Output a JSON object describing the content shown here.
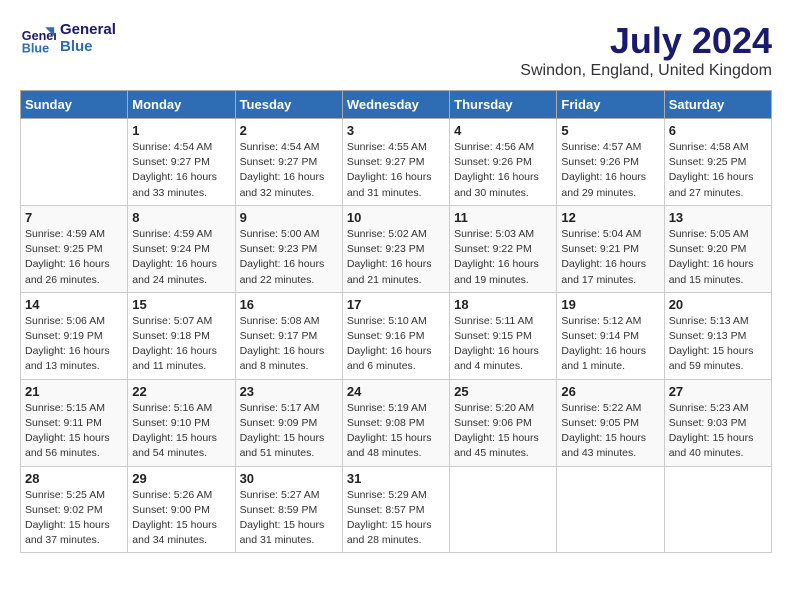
{
  "logo": {
    "line1": "General",
    "line2": "Blue"
  },
  "title": "July 2024",
  "location": "Swindon, England, United Kingdom",
  "days_of_week": [
    "Sunday",
    "Monday",
    "Tuesday",
    "Wednesday",
    "Thursday",
    "Friday",
    "Saturday"
  ],
  "weeks": [
    [
      {
        "num": "",
        "info": ""
      },
      {
        "num": "1",
        "info": "Sunrise: 4:54 AM\nSunset: 9:27 PM\nDaylight: 16 hours\nand 33 minutes."
      },
      {
        "num": "2",
        "info": "Sunrise: 4:54 AM\nSunset: 9:27 PM\nDaylight: 16 hours\nand 32 minutes."
      },
      {
        "num": "3",
        "info": "Sunrise: 4:55 AM\nSunset: 9:27 PM\nDaylight: 16 hours\nand 31 minutes."
      },
      {
        "num": "4",
        "info": "Sunrise: 4:56 AM\nSunset: 9:26 PM\nDaylight: 16 hours\nand 30 minutes."
      },
      {
        "num": "5",
        "info": "Sunrise: 4:57 AM\nSunset: 9:26 PM\nDaylight: 16 hours\nand 29 minutes."
      },
      {
        "num": "6",
        "info": "Sunrise: 4:58 AM\nSunset: 9:25 PM\nDaylight: 16 hours\nand 27 minutes."
      }
    ],
    [
      {
        "num": "7",
        "info": "Sunrise: 4:59 AM\nSunset: 9:25 PM\nDaylight: 16 hours\nand 26 minutes."
      },
      {
        "num": "8",
        "info": "Sunrise: 4:59 AM\nSunset: 9:24 PM\nDaylight: 16 hours\nand 24 minutes."
      },
      {
        "num": "9",
        "info": "Sunrise: 5:00 AM\nSunset: 9:23 PM\nDaylight: 16 hours\nand 22 minutes."
      },
      {
        "num": "10",
        "info": "Sunrise: 5:02 AM\nSunset: 9:23 PM\nDaylight: 16 hours\nand 21 minutes."
      },
      {
        "num": "11",
        "info": "Sunrise: 5:03 AM\nSunset: 9:22 PM\nDaylight: 16 hours\nand 19 minutes."
      },
      {
        "num": "12",
        "info": "Sunrise: 5:04 AM\nSunset: 9:21 PM\nDaylight: 16 hours\nand 17 minutes."
      },
      {
        "num": "13",
        "info": "Sunrise: 5:05 AM\nSunset: 9:20 PM\nDaylight: 16 hours\nand 15 minutes."
      }
    ],
    [
      {
        "num": "14",
        "info": "Sunrise: 5:06 AM\nSunset: 9:19 PM\nDaylight: 16 hours\nand 13 minutes."
      },
      {
        "num": "15",
        "info": "Sunrise: 5:07 AM\nSunset: 9:18 PM\nDaylight: 16 hours\nand 11 minutes."
      },
      {
        "num": "16",
        "info": "Sunrise: 5:08 AM\nSunset: 9:17 PM\nDaylight: 16 hours\nand 8 minutes."
      },
      {
        "num": "17",
        "info": "Sunrise: 5:10 AM\nSunset: 9:16 PM\nDaylight: 16 hours\nand 6 minutes."
      },
      {
        "num": "18",
        "info": "Sunrise: 5:11 AM\nSunset: 9:15 PM\nDaylight: 16 hours\nand 4 minutes."
      },
      {
        "num": "19",
        "info": "Sunrise: 5:12 AM\nSunset: 9:14 PM\nDaylight: 16 hours\nand 1 minute."
      },
      {
        "num": "20",
        "info": "Sunrise: 5:13 AM\nSunset: 9:13 PM\nDaylight: 15 hours\nand 59 minutes."
      }
    ],
    [
      {
        "num": "21",
        "info": "Sunrise: 5:15 AM\nSunset: 9:11 PM\nDaylight: 15 hours\nand 56 minutes."
      },
      {
        "num": "22",
        "info": "Sunrise: 5:16 AM\nSunset: 9:10 PM\nDaylight: 15 hours\nand 54 minutes."
      },
      {
        "num": "23",
        "info": "Sunrise: 5:17 AM\nSunset: 9:09 PM\nDaylight: 15 hours\nand 51 minutes."
      },
      {
        "num": "24",
        "info": "Sunrise: 5:19 AM\nSunset: 9:08 PM\nDaylight: 15 hours\nand 48 minutes."
      },
      {
        "num": "25",
        "info": "Sunrise: 5:20 AM\nSunset: 9:06 PM\nDaylight: 15 hours\nand 45 minutes."
      },
      {
        "num": "26",
        "info": "Sunrise: 5:22 AM\nSunset: 9:05 PM\nDaylight: 15 hours\nand 43 minutes."
      },
      {
        "num": "27",
        "info": "Sunrise: 5:23 AM\nSunset: 9:03 PM\nDaylight: 15 hours\nand 40 minutes."
      }
    ],
    [
      {
        "num": "28",
        "info": "Sunrise: 5:25 AM\nSunset: 9:02 PM\nDaylight: 15 hours\nand 37 minutes."
      },
      {
        "num": "29",
        "info": "Sunrise: 5:26 AM\nSunset: 9:00 PM\nDaylight: 15 hours\nand 34 minutes."
      },
      {
        "num": "30",
        "info": "Sunrise: 5:27 AM\nSunset: 8:59 PM\nDaylight: 15 hours\nand 31 minutes."
      },
      {
        "num": "31",
        "info": "Sunrise: 5:29 AM\nSunset: 8:57 PM\nDaylight: 15 hours\nand 28 minutes."
      },
      {
        "num": "",
        "info": ""
      },
      {
        "num": "",
        "info": ""
      },
      {
        "num": "",
        "info": ""
      }
    ]
  ]
}
